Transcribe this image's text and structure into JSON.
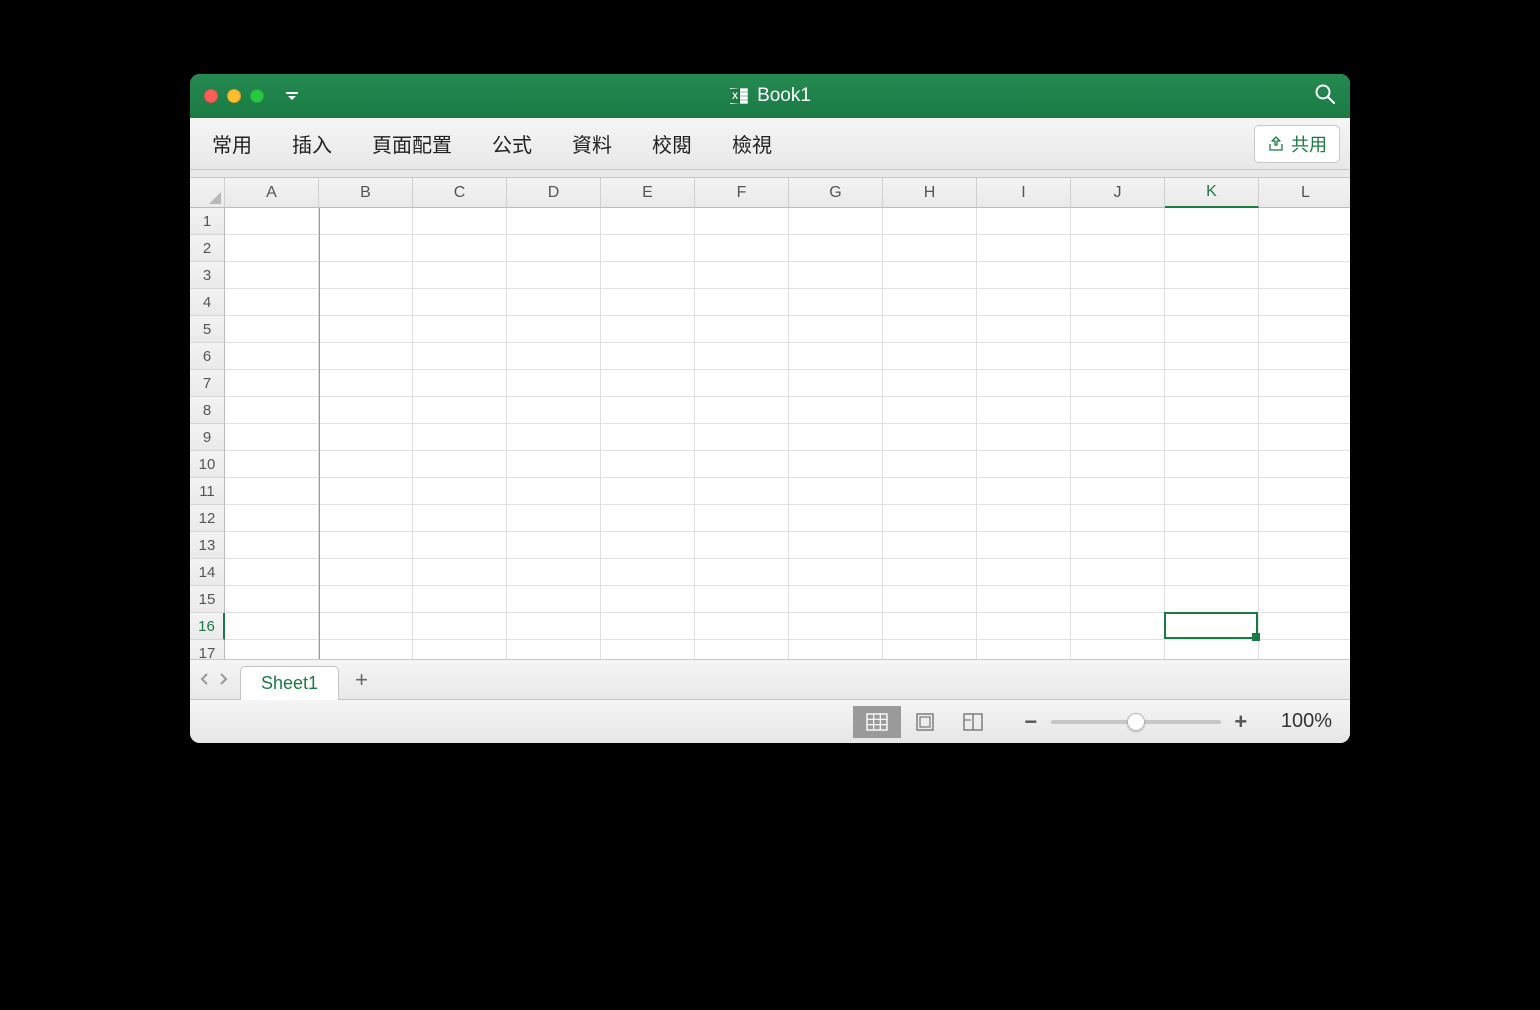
{
  "window": {
    "title": "Book1"
  },
  "ribbon": {
    "tabs": [
      "常用",
      "插入",
      "頁面配置",
      "公式",
      "資料",
      "校閱",
      "檢視"
    ],
    "share_label": "共用"
  },
  "grid": {
    "columns": [
      "A",
      "B",
      "C",
      "D",
      "E",
      "F",
      "G",
      "H",
      "I",
      "J",
      "K",
      "L"
    ],
    "rows": [
      "1",
      "2",
      "3",
      "4",
      "5",
      "6",
      "7",
      "8",
      "9",
      "10",
      "11",
      "12",
      "13",
      "14",
      "15",
      "16",
      "17"
    ],
    "selected_cell": {
      "row": 16,
      "column": "K"
    }
  },
  "sheets": {
    "active": "Sheet1"
  },
  "statusbar": {
    "zoom": "100%"
  },
  "colors": {
    "accent": "#1a7a44"
  }
}
